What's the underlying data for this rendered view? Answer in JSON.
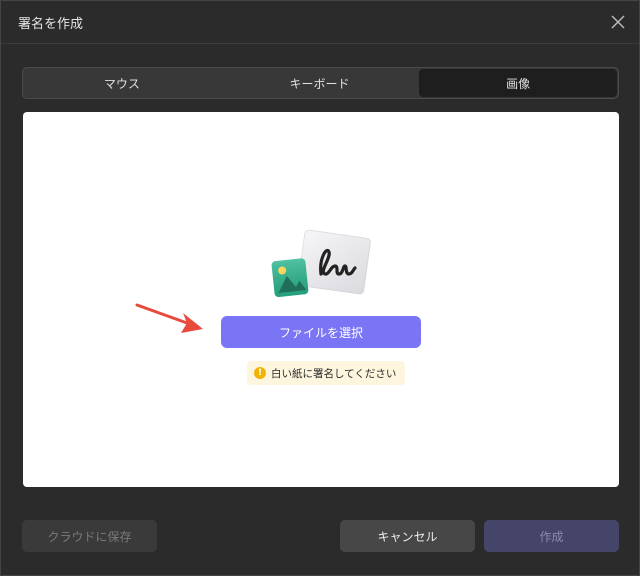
{
  "window": {
    "title": "署名を作成"
  },
  "tabs": [
    {
      "label": "マウス",
      "active": false
    },
    {
      "label": "キーボード",
      "active": false
    },
    {
      "label": "画像",
      "active": true
    }
  ],
  "main": {
    "select_file_label": "ファイルを選択",
    "hint_icon": "!",
    "hint_text": "白い紙に署名してください"
  },
  "footer": {
    "cloud_save_label": "クラウドに保存",
    "cancel_label": "キャンセル",
    "create_label": "作成"
  },
  "colors": {
    "accent": "#7a75f4",
    "hint_bg": "#fdf5dd",
    "warning": "#f0b400",
    "arrow": "#e84a3c"
  }
}
